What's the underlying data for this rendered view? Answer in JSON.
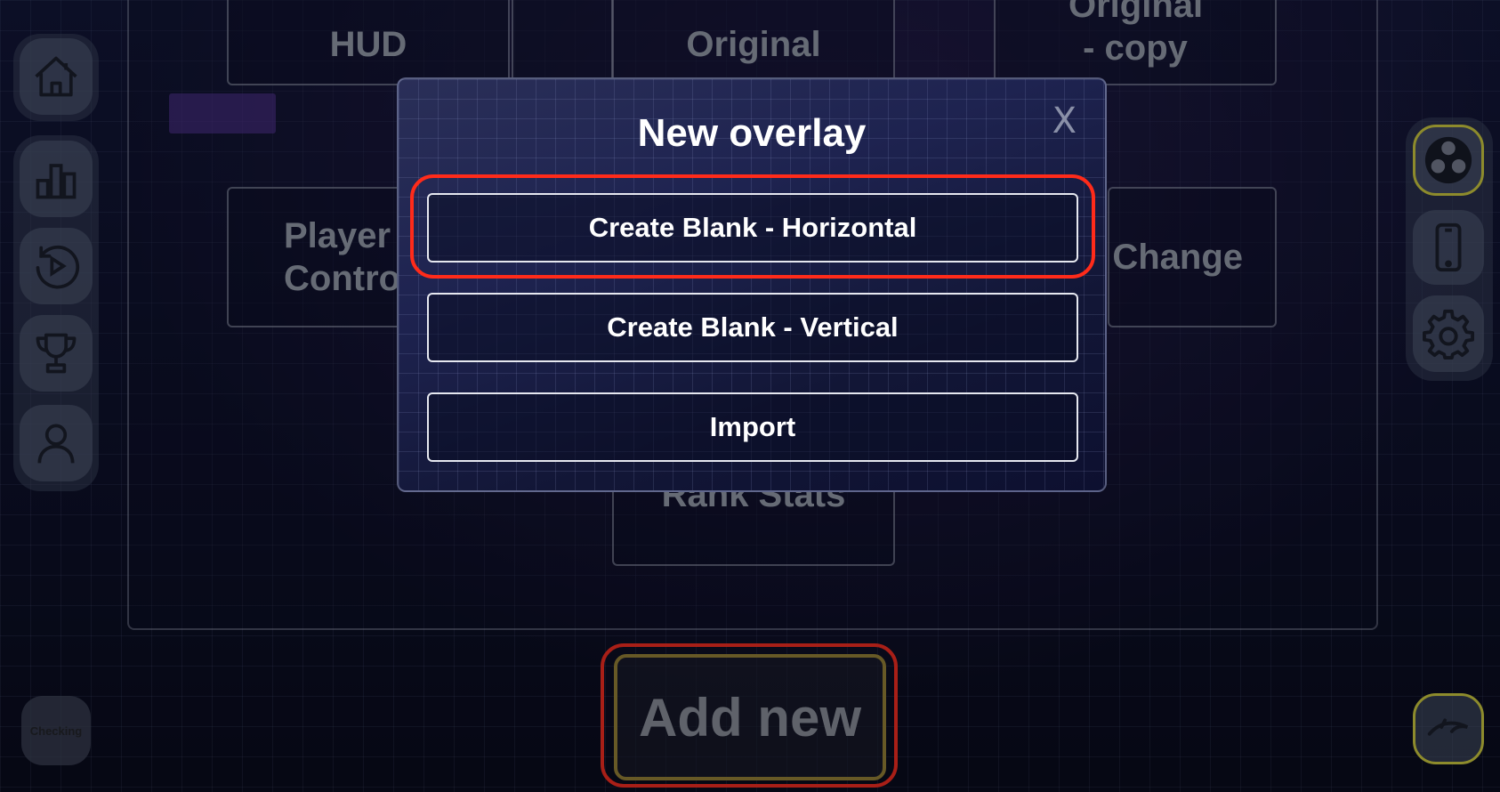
{
  "sidebar": {
    "items": [
      {
        "icon": "home-icon"
      },
      {
        "icon": "bar-chart-icon"
      },
      {
        "icon": "replay-icon"
      },
      {
        "icon": "trophy-icon"
      },
      {
        "icon": "user-icon"
      }
    ]
  },
  "overlays": {
    "tiles": [
      "HUD",
      "Original",
      "Original - copy",
      "Player Controls",
      "Change",
      "Rank Stats"
    ]
  },
  "modal": {
    "title": "New overlay",
    "close_label": "X",
    "options": [
      "Create Blank - Horizontal",
      "Create Blank - Vertical",
      "Import"
    ]
  },
  "footer": {
    "add_new_label": "Add new",
    "status_label": "Checking"
  },
  "right_rail": {
    "items": [
      {
        "icon": "obs-icon"
      },
      {
        "icon": "mobile-phone-icon"
      },
      {
        "icon": "gear-icon"
      }
    ],
    "bottom_icon": "dolphin-icon"
  },
  "colors": {
    "highlight": "#ff2b1a",
    "add_button_border": "#9c8430",
    "obs_border": "#d6d23a"
  }
}
